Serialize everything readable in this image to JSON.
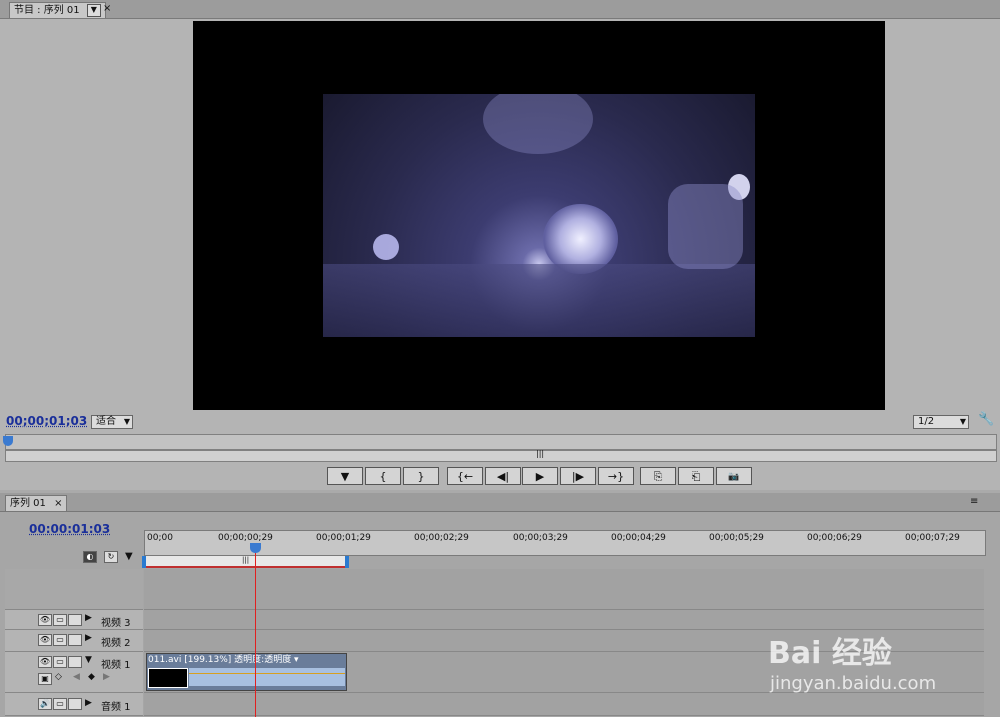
{
  "program_monitor": {
    "tab_label": "节目 : 序列 01",
    "close": "×",
    "timecode": "00;00;01;03",
    "zoom": "适合",
    "resolution": "1/2"
  },
  "transport": {
    "buttons": [
      "▼",
      "{",
      "}",
      "{←",
      "◀|",
      "▶",
      "|▶",
      "→}",
      "⎘",
      "⎗",
      "📷"
    ]
  },
  "scrollbar_grip": "|||",
  "timeline": {
    "tab_label": "序列 01",
    "close": "×",
    "timecode": "00:00:01:03",
    "ruler_ticks": [
      "00;00",
      "00;00;00;29",
      "00;00;01;29",
      "00;00;02;29",
      "00;00;03;29",
      "00;00;04;29",
      "00;00;05;29",
      "00;00;06;29",
      "00;00;07;29"
    ],
    "tracks": [
      {
        "label": "视频 3"
      },
      {
        "label": "视频 2"
      },
      {
        "label": "视频 1"
      },
      {
        "label": "音频 1"
      }
    ],
    "clip": {
      "title": "011.avi [199.13%]  透明度:透明度 ▾"
    }
  },
  "watermark": {
    "brand": "Bai 经验",
    "url": "jingyan.baidu.com"
  }
}
